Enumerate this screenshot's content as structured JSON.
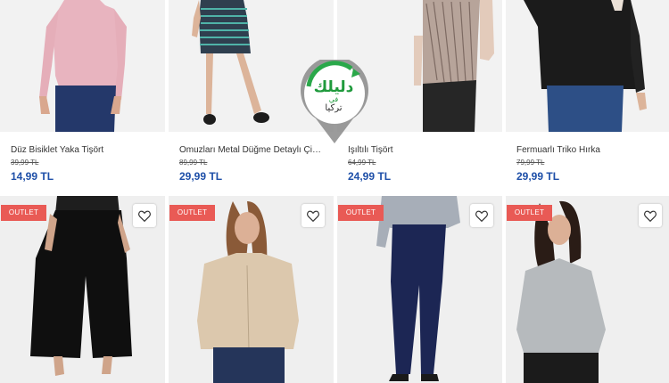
{
  "products_row1": [
    {
      "name": "Düz Bisiklet Yaka Tişört",
      "old_price": "39,99 TL",
      "price": "14,99 TL"
    },
    {
      "name": "Omuzları Metal Düğme Detaylı Çizgil...",
      "old_price": "89,99 TL",
      "price": "29,99 TL"
    },
    {
      "name": "Işıltılı Tişört",
      "old_price": "64,99 TL",
      "price": "24,99 TL"
    },
    {
      "name": "Fermuarlı Triko Hırka",
      "old_price": "79,99 TL",
      "price": "29,99 TL"
    }
  ],
  "products_row2": [
    {
      "badge": "OUTLET",
      "icon": "heart-icon"
    },
    {
      "badge": "OUTLET",
      "icon": "heart-icon"
    },
    {
      "badge": "OUTLET",
      "icon": "heart-icon"
    },
    {
      "badge": "OUTLET",
      "icon": "heart-icon"
    }
  ],
  "watermark": {
    "line1": "دليلك",
    "line2": "في",
    "line3": "تركيا",
    "color": "#1f9a3c"
  },
  "colors": {
    "price": "#1e4fa8",
    "outlet_badge": "#e95a55"
  }
}
